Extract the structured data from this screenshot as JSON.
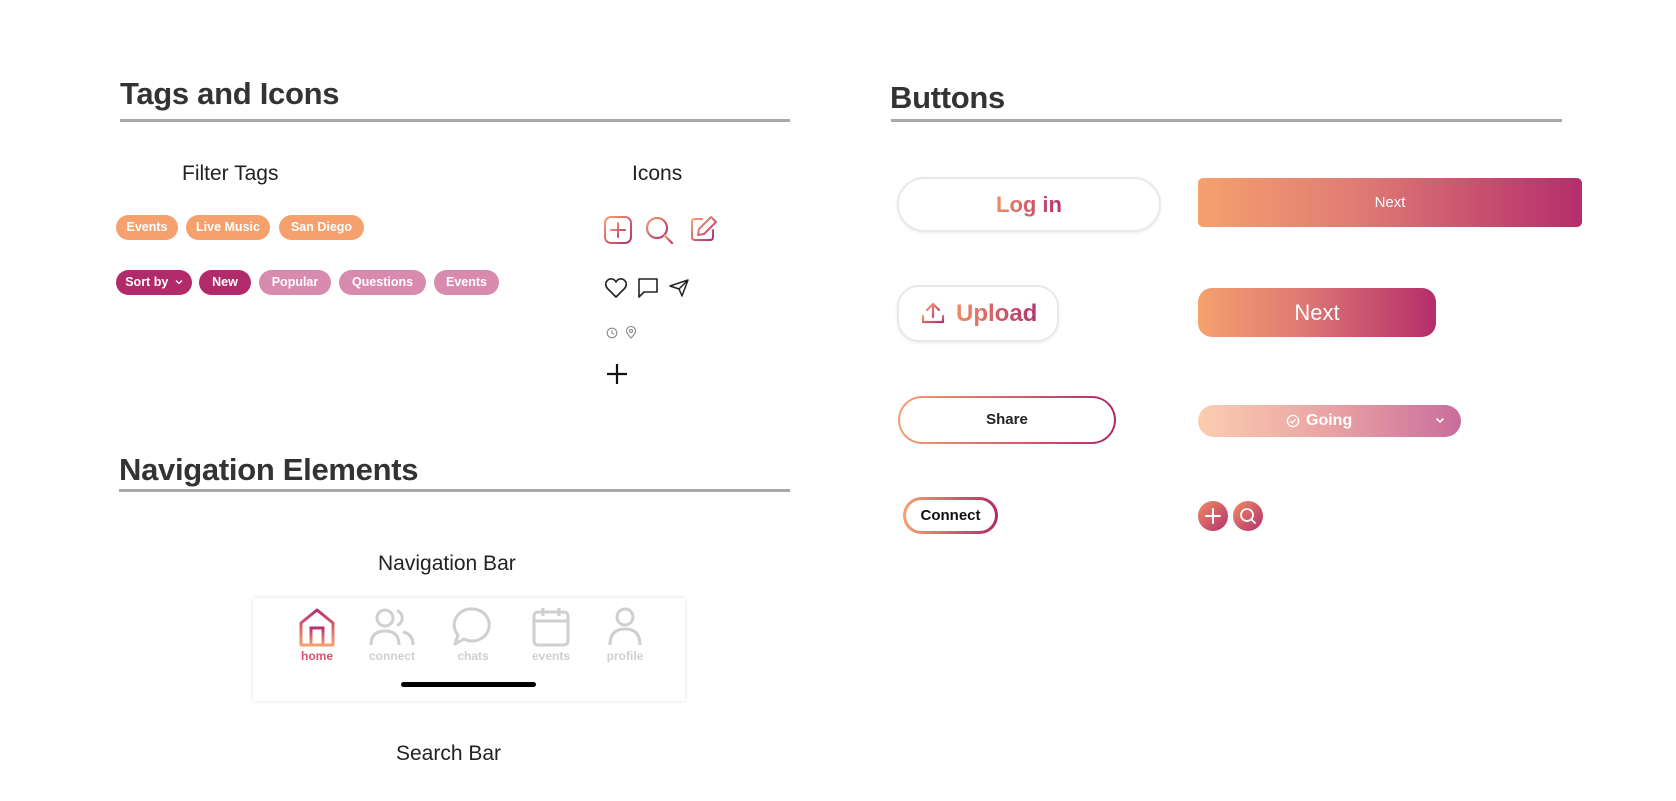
{
  "sections": {
    "tags_and_icons": "Tags and Icons",
    "buttons": "Buttons",
    "navigation_elements": "Navigation Elements"
  },
  "filter_tags": {
    "title": "Filter Tags",
    "row1": [
      "Events",
      "Live Music",
      "San Diego"
    ],
    "row2": {
      "sort_by": "Sort by",
      "new": "New",
      "popular": "Popular",
      "questions": "Questions",
      "events": "Events"
    }
  },
  "icons": {
    "title": "Icons",
    "names": [
      "add-icon",
      "search-icon",
      "edit-icon",
      "heart-icon",
      "comment-icon",
      "send-icon",
      "clock-icon",
      "location-pin-icon",
      "plus-icon"
    ]
  },
  "buttons": {
    "login": "Log in",
    "next_primary": "Next",
    "upload": "Upload",
    "next_rounded": "Next",
    "share": "Share",
    "going": "Going",
    "connect": "Connect"
  },
  "navigation": {
    "nav_bar_title": "Navigation Bar",
    "items": [
      {
        "label": "home",
        "icon": "home-icon",
        "active": true
      },
      {
        "label": "connect",
        "icon": "people-icon",
        "active": false
      },
      {
        "label": "chats",
        "icon": "chat-bubble-icon",
        "active": false
      },
      {
        "label": "events",
        "icon": "calendar-icon",
        "active": false
      },
      {
        "label": "profile",
        "icon": "profile-icon",
        "active": false
      }
    ],
    "search_bar_title": "Search Bar"
  },
  "colors": {
    "gradient_start": "#f6a06e",
    "gradient_end": "#b12a6a",
    "tag_orange": "#f6a06e",
    "tag_dark": "#b12a6a",
    "tag_light": "#d98aaf",
    "inactive_gray": "#cfcfcf",
    "rule_gray": "#a8a8a8"
  }
}
